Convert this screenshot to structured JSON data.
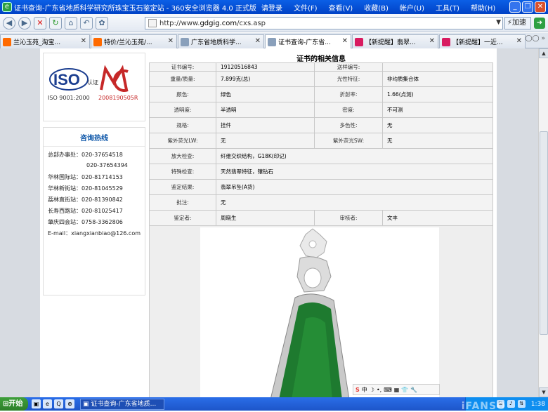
{
  "window": {
    "title": "证书查询-广东省地质科学研究所珠宝玉石鉴定站 - 360安全浏览器 4.0 正式版",
    "menus": [
      "请登录",
      "文件(F)",
      "查看(V)",
      "收藏(B)",
      "帐户(U)",
      "工具(T)",
      "帮助(H)"
    ]
  },
  "nav": {
    "url_prefix": "http://www.",
    "url_host": "gdgig.com",
    "url_path": "/cxs.asp",
    "speed_label": "加速"
  },
  "tabs": [
    {
      "label": "兰沁玉苑_淘宝...",
      "icon": "taobao-icon",
      "color": "#ff6a00"
    },
    {
      "label": "特价/兰沁玉苑/...",
      "icon": "taobao-icon",
      "color": "#ff6a00"
    },
    {
      "label": "广东省地质科学...",
      "icon": "page-icon",
      "color": "#8aa0bb"
    },
    {
      "label": "证书查询-广东省...",
      "icon": "page-icon",
      "color": "#8aa0bb"
    },
    {
      "label": "【新提醒】翡翠...",
      "icon": "gem-icon",
      "color": "#d81b60"
    },
    {
      "label": "【新提醒】一近...",
      "icon": "gem-icon",
      "color": "#d81b60"
    }
  ],
  "logos": {
    "iso": "ISO",
    "iso_sub": "认证",
    "iso_code": "ISO 9001:2000",
    "cma": "CMA",
    "cma_code": "2008190505R"
  },
  "hotline": {
    "title": "咨询热线",
    "rows": [
      "总部办事处：020-37654518",
      "020-37654394",
      "华林国际站：020-81714153",
      "华林新街站：020-81045529",
      "荔林直街站：020-81390842",
      "长寿西路站：020-81025417",
      "肇庆四会站：0758-3362806",
      "E-mail：xiangxianbiao@126.com"
    ]
  },
  "cert": {
    "title": "证书的相关信息",
    "rows": [
      [
        "证书编号:",
        "19120516843",
        "送样编号:",
        ""
      ],
      [
        "重量/质量:",
        "7.899克(总)",
        "光性特征:",
        "非均质集合体"
      ],
      [
        "颜色:",
        "绿色",
        "折射率:",
        "1.66(点测)"
      ],
      [
        "透明度:",
        "半透明",
        "密度:",
        "不可测"
      ],
      [
        "规格:",
        "挂件",
        "多色性:",
        "无"
      ],
      [
        "紫外荧光LW:",
        "无",
        "紫外荧光SW:",
        "无"
      ],
      [
        "放大检查:",
        "纤维交织结构，G18K(印记)"
      ],
      [
        "特殊检查:",
        "天然翡翠特征，镶钻石"
      ],
      [
        "鉴定结果:",
        "翡翠吊坠(A货)"
      ],
      [
        "批注:",
        "无"
      ],
      [
        "鉴定者:",
        "周晓生",
        "审核者:",
        "文丰"
      ]
    ]
  },
  "taskbar": {
    "start": "开始",
    "task": "证书查询-广东省地质...",
    "clock": "1:38"
  },
  "watermark": "iFANSO"
}
